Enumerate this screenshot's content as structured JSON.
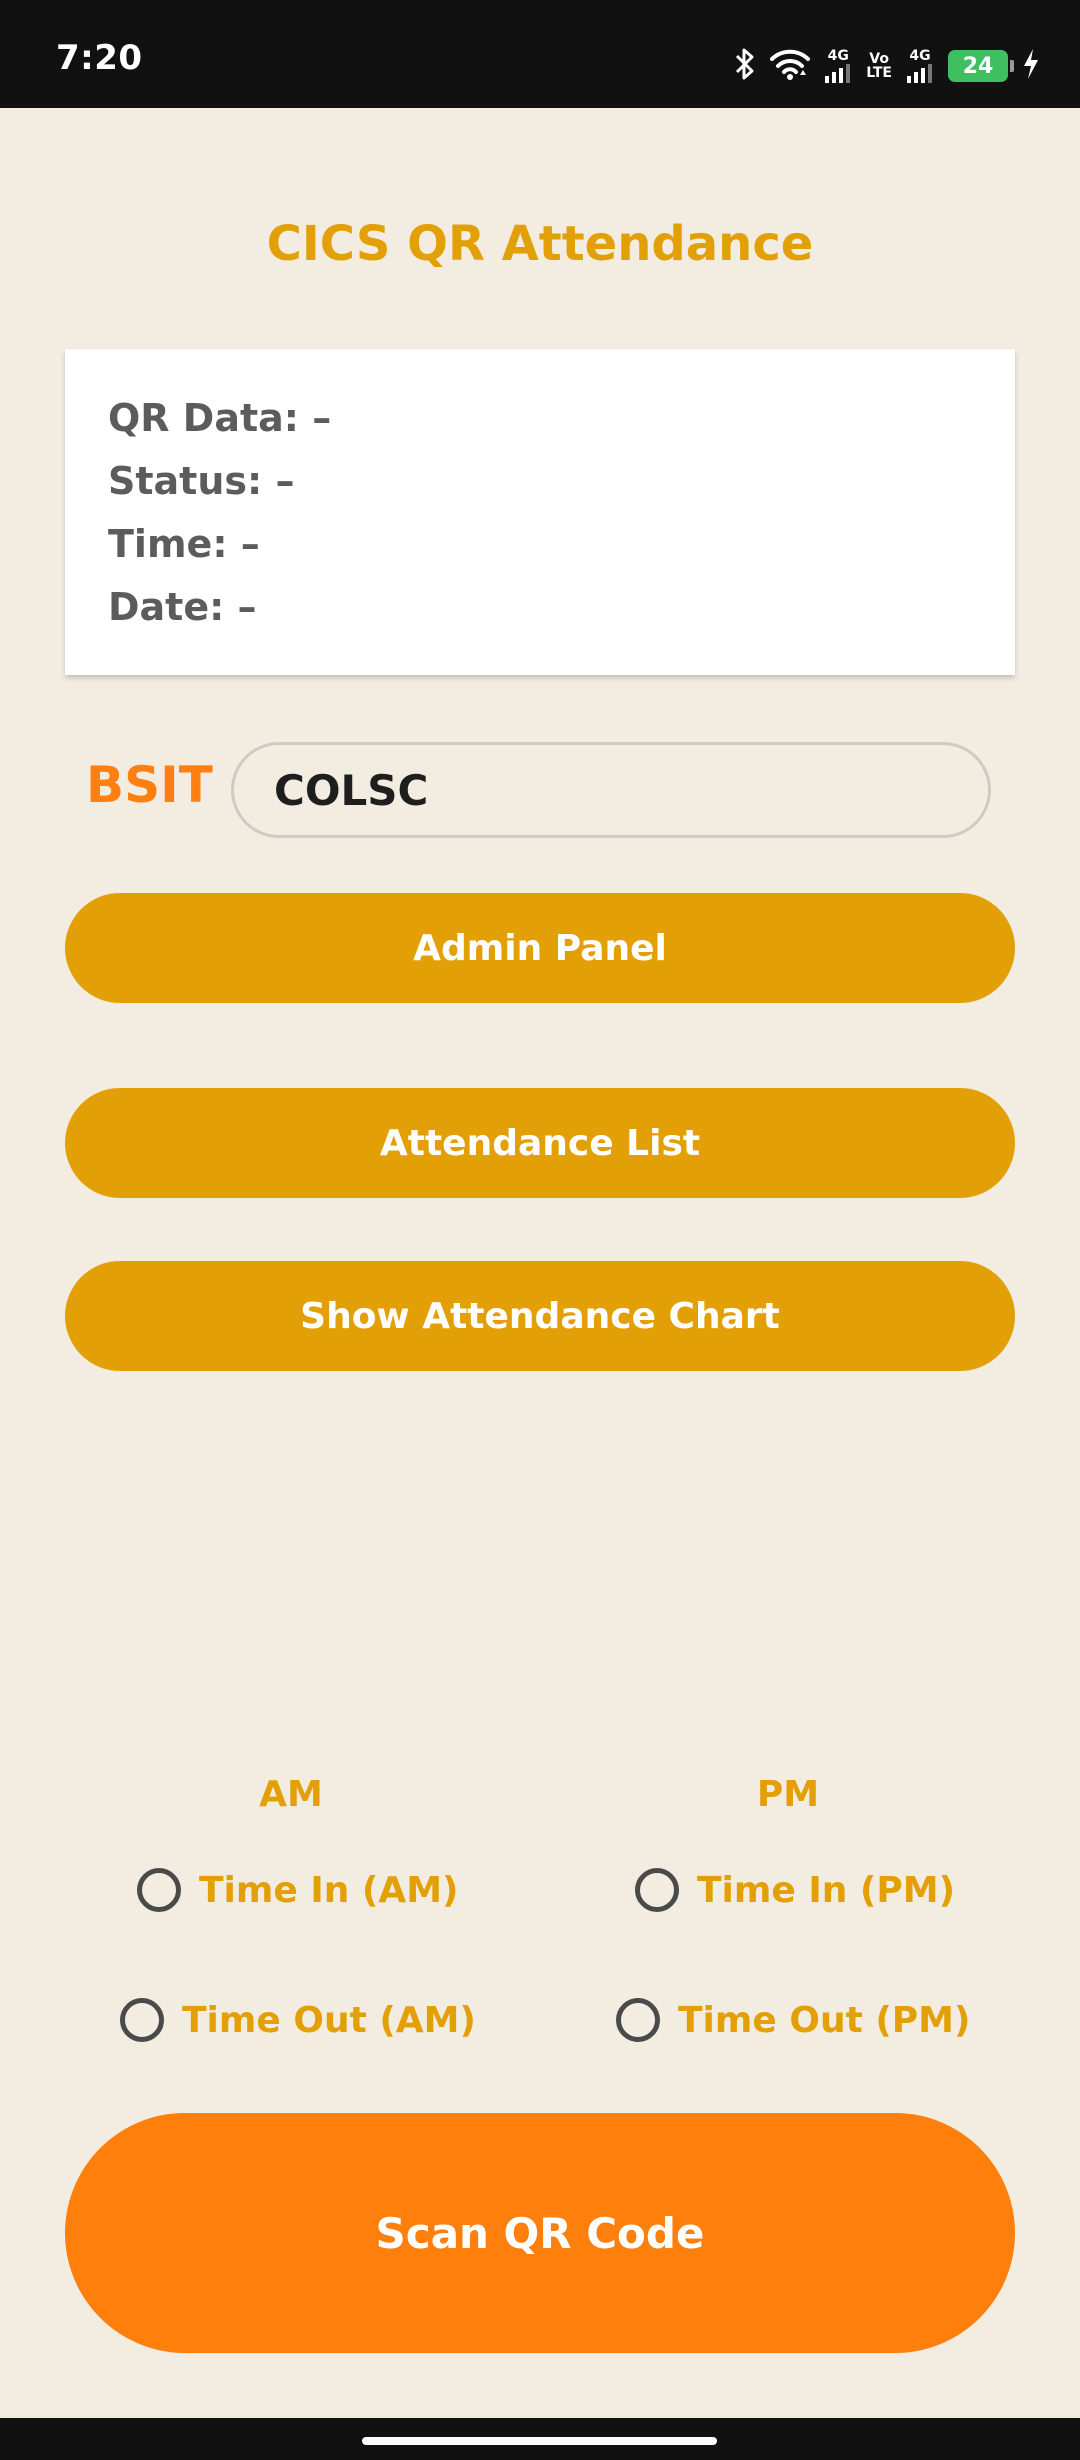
{
  "status_bar": {
    "time": "7:20",
    "network_1": "4G",
    "volte_top": "Vo",
    "volte_bottom": "LTE",
    "network_2": "4G",
    "battery": "24"
  },
  "app": {
    "title": "CICS QR Attendance"
  },
  "info": {
    "qr_data": "QR Data: –",
    "status": "Status: –",
    "time": "Time: –",
    "date": "Date: –"
  },
  "program": {
    "label": "BSIT",
    "org_value": "COLSC"
  },
  "buttons": {
    "admin_panel": "Admin Panel",
    "attendance_list": "Attendance List",
    "show_chart": "Show Attendance Chart",
    "scan_qr": "Scan QR Code"
  },
  "session": {
    "am_header": "AM",
    "pm_header": "PM",
    "time_in_am": "Time In (AM)",
    "time_in_pm": "Time In (PM)",
    "time_out_am": "Time Out (AM)",
    "time_out_pm": "Time Out (PM)"
  },
  "colors": {
    "background": "#f2ece1",
    "accent_gold": "#e3a006",
    "accent_orange": "#ff7f0d",
    "battery_green": "#3fbf5f"
  },
  "icons": [
    "bluetooth-icon",
    "wifi-icon",
    "signal-icon",
    "battery-icon",
    "charging-icon"
  ]
}
